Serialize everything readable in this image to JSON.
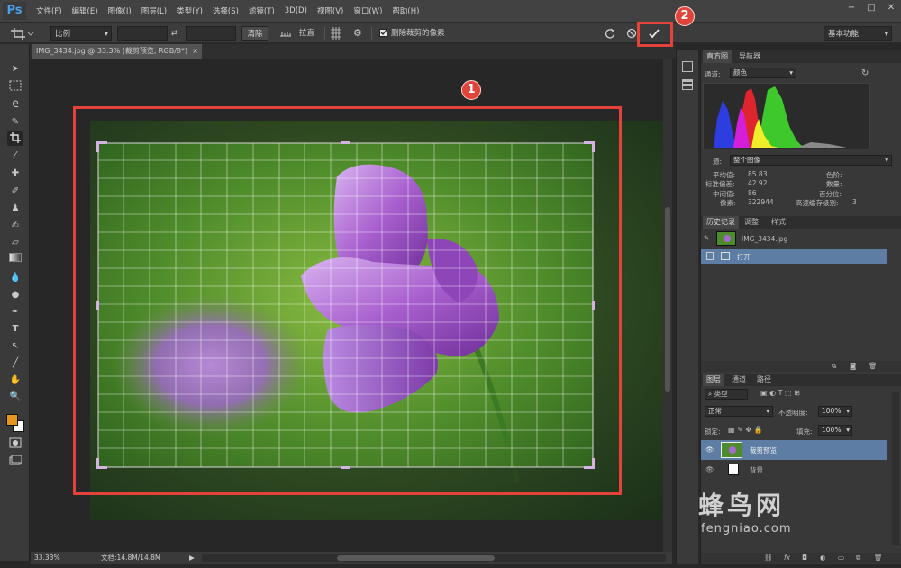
{
  "app": {
    "logo": "Ps"
  },
  "menu": [
    "文件(F)",
    "编辑(E)",
    "图像(I)",
    "图层(L)",
    "类型(Y)",
    "选择(S)",
    "滤镜(T)",
    "3D(D)",
    "视图(V)",
    "窗口(W)",
    "帮助(H)"
  ],
  "window_controls": [
    "−",
    "□",
    "✕"
  ],
  "options": {
    "ratio": "比例",
    "clear": "清除",
    "straighten": "拉直",
    "delete_cropped": "删除裁剪的像素",
    "workspace": "基本功能"
  },
  "document": {
    "tab_title": "IMG_3434.jpg @ 33.3% (裁剪预览, RGB/8*)",
    "tab_close": "×"
  },
  "status": {
    "zoom": "33.33%",
    "doc_size": "文档:14.8M/14.8M"
  },
  "histogram": {
    "tabs": [
      "直方图",
      "导航器"
    ],
    "channel_label": "通道:",
    "channel_value": "颜色",
    "source_label": "源:",
    "source_value": "整个图像",
    "stats": {
      "mean_label": "平均值:",
      "mean": "85.83",
      "std_label": "标准偏差:",
      "std": "42.92",
      "median_label": "中间值:",
      "median": "86",
      "pixels_label": "像素:",
      "pixels": "322944",
      "level_label": "色阶:",
      "count_label": "数量:",
      "percentile_label": "百分位:",
      "cache_label": "高速缓存级别:",
      "cache": "3"
    }
  },
  "history": {
    "tabs": [
      "历史记录",
      "调整",
      "样式"
    ],
    "snapshot": "IMG_3434.jpg",
    "items": [
      "打开"
    ]
  },
  "layers": {
    "tabs": [
      "图层",
      "通道",
      "路径"
    ],
    "kind": "类型",
    "blend_mode": "正常",
    "opacity_label": "不透明度:",
    "opacity": "100%",
    "lock_label": "锁定:",
    "fill_label": "填充:",
    "fill": "100%",
    "items": [
      "裁剪预览",
      "背景"
    ]
  },
  "annotations": {
    "badge1": "1",
    "badge2": "2"
  },
  "watermark": {
    "cn": "蜂鸟网",
    "en": "fengniao.com"
  },
  "colors": {
    "foreground": "#e5961f",
    "background": "#ffffff",
    "annotation": "#e4423a",
    "selection": "#5d7da4"
  }
}
